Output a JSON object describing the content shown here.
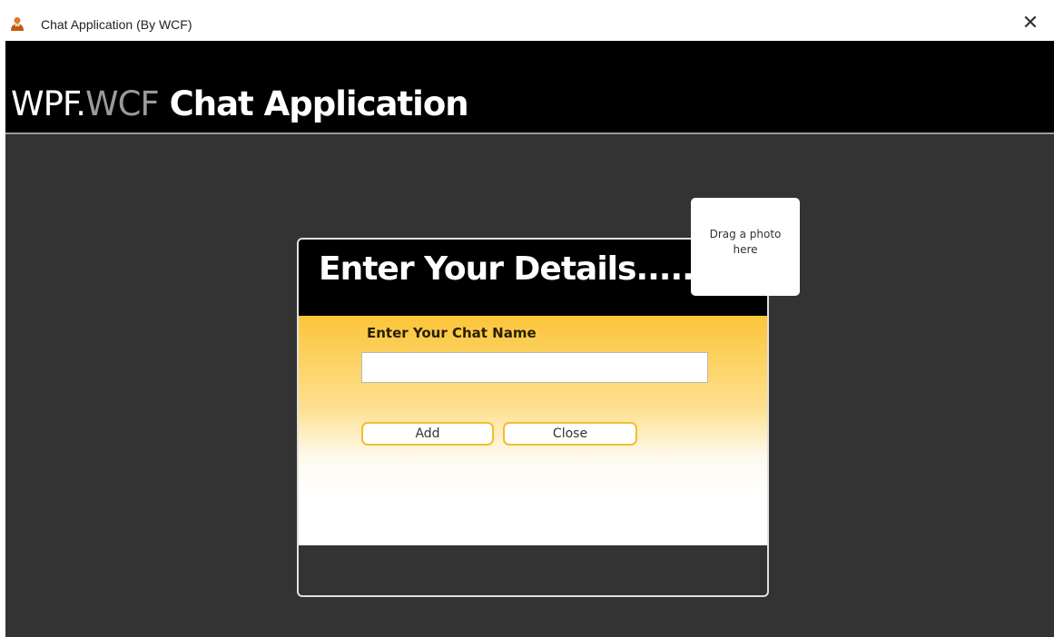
{
  "window": {
    "title": "Chat Application (By WCF)",
    "close_glyph": "✕"
  },
  "header": {
    "brand_part1": "WPF.",
    "brand_part2": "WCF",
    "brand_part3": " Chat Application"
  },
  "dialog": {
    "title": "Enter Your Details......",
    "field_label": "Enter Your Chat Name",
    "name_value": "",
    "add_label": "Add",
    "close_label": "Close"
  },
  "photo": {
    "line1": "Drag a photo",
    "line2": "here"
  },
  "colors": {
    "background": "#333333",
    "header": "#000000",
    "accent_gold": "#fcc53a",
    "button_border": "#f2bf2a"
  },
  "icons": {
    "app": "user-icon",
    "close": "close-icon"
  }
}
